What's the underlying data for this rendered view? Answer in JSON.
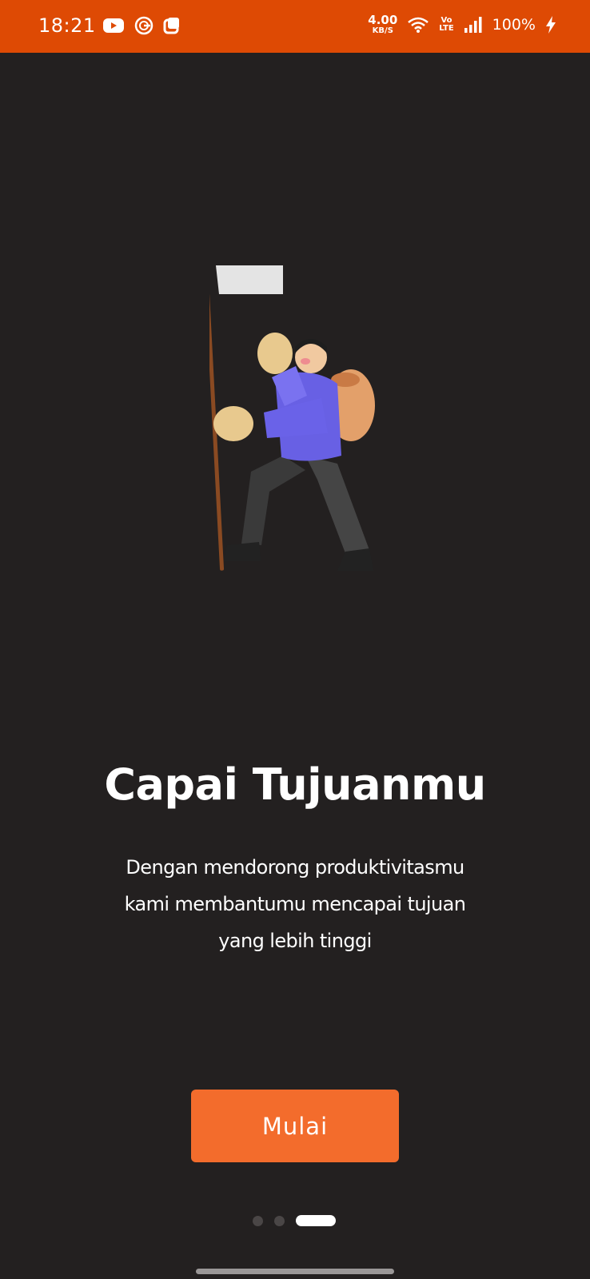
{
  "status_bar": {
    "time": "18:21",
    "left_icons": [
      "youtube-icon",
      "g-app-icon",
      "square-app-icon"
    ],
    "net_speed_value": "4.00",
    "net_speed_unit": "KB/S",
    "volte_top": "Vo",
    "volte_bottom": "LTE",
    "battery": "100%",
    "background_color": "#de4a04"
  },
  "onboarding": {
    "title": "Capai Tujuanmu",
    "description_lines": [
      "Dengan mendorong produktivitasmu",
      "kami membantumu mencapai tujuan",
      "yang lebih tinggi"
    ],
    "start_button_label": "Mulai",
    "accent_color": "#f36c2c",
    "page_count": 3,
    "current_page": 3
  }
}
